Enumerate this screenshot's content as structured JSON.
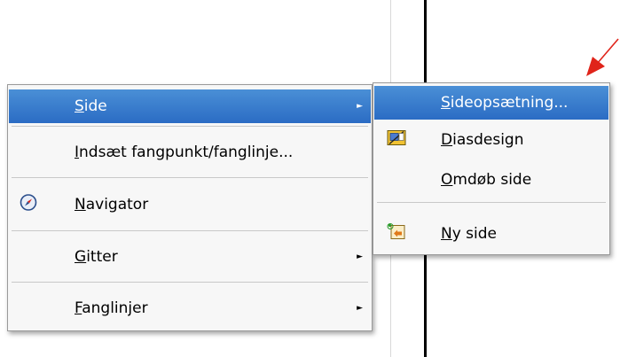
{
  "main_menu": {
    "items": [
      {
        "mnemonic": "S",
        "rest": "ide",
        "has_submenu": true,
        "highlighted": true
      },
      {
        "mnemonic": "I",
        "rest": "ndsæt fangpunkt/fanglinje...",
        "has_submenu": false
      },
      {
        "mnemonic": "N",
        "rest": "avigator",
        "icon": "navigator-compass-icon",
        "has_submenu": false
      },
      {
        "mnemonic": "G",
        "rest": "itter",
        "has_submenu": true
      },
      {
        "mnemonic": "F",
        "rest": "anglinjer",
        "has_submenu": true
      }
    ]
  },
  "sub_menu": {
    "items": [
      {
        "mnemonic": "S",
        "rest": "ideopsætning...",
        "highlighted": true
      },
      {
        "mnemonic": "D",
        "rest": "iasdesign",
        "icon": "slide-design-icon"
      },
      {
        "mnemonic": "O",
        "rest": "mdøb side"
      },
      {
        "mnemonic": "N",
        "rest": "y side",
        "icon": "new-slide-icon"
      }
    ]
  },
  "submenu_arrow": "►",
  "colors": {
    "highlight": "#3a7dcf",
    "annotation_arrow": "#e0241a"
  }
}
